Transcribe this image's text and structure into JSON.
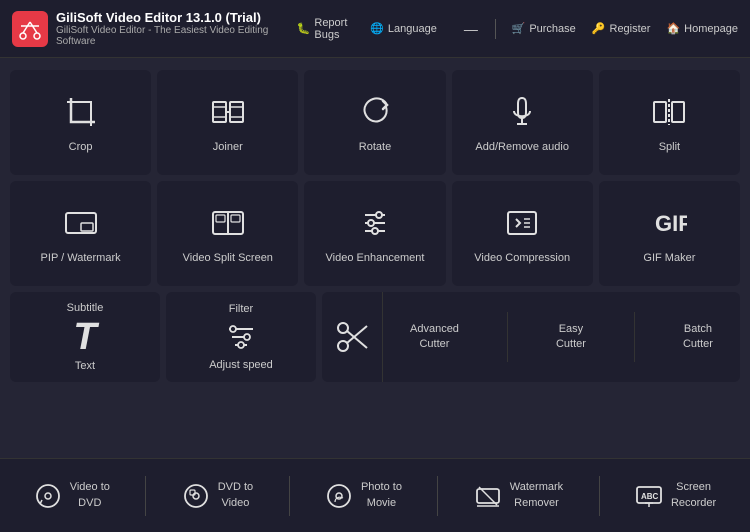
{
  "app": {
    "title": "GiliSoft Video Editor 13.1.0 (Trial)",
    "subtitle": "GiliSoft Video Editor - The Easiest Video Editing Software",
    "logo_icon": "✂"
  },
  "titlebar": {
    "report_bugs": "Report Bugs",
    "language": "Language",
    "minimize": "—",
    "purchase": "Purchase",
    "register": "Register",
    "homepage": "Homepage"
  },
  "tools_row1": [
    {
      "id": "crop",
      "label": "Crop"
    },
    {
      "id": "joiner",
      "label": "Joiner"
    },
    {
      "id": "rotate",
      "label": "Rotate"
    },
    {
      "id": "add-remove-audio",
      "label": "Add/Remove audio"
    },
    {
      "id": "split",
      "label": "Split"
    }
  ],
  "tools_row2": [
    {
      "id": "pip-watermark",
      "label": "PIP / Watermark"
    },
    {
      "id": "video-split-screen",
      "label": "Video Split Screen"
    },
    {
      "id": "video-enhancement",
      "label": "Video Enhancement"
    },
    {
      "id": "video-compression",
      "label": "Video Compression"
    },
    {
      "id": "gif-maker",
      "label": "GIF Maker"
    }
  ],
  "tools_row3_text": {
    "subtitle_label": "Subtitle",
    "text_label": "Text"
  },
  "tools_row3_filter": {
    "filter_label": "Filter",
    "adjust_label": "Adjust speed"
  },
  "tools_row3_cutters": {
    "advanced_label": "Advanced\nCutter",
    "easy_label": "Easy\nCutter",
    "batch_label": "Batch\nCutter"
  },
  "bottom_tools": [
    {
      "id": "video-to-dvd",
      "label": "Video to\nDVD"
    },
    {
      "id": "dvd-to-video",
      "label": "DVD to\nVideo"
    },
    {
      "id": "photo-to-movie",
      "label": "Photo to\nMovie"
    },
    {
      "id": "watermark-remover",
      "label": "Watermark\nRemover"
    },
    {
      "id": "screen-recorder",
      "label": "Screen\nRecorder"
    }
  ]
}
